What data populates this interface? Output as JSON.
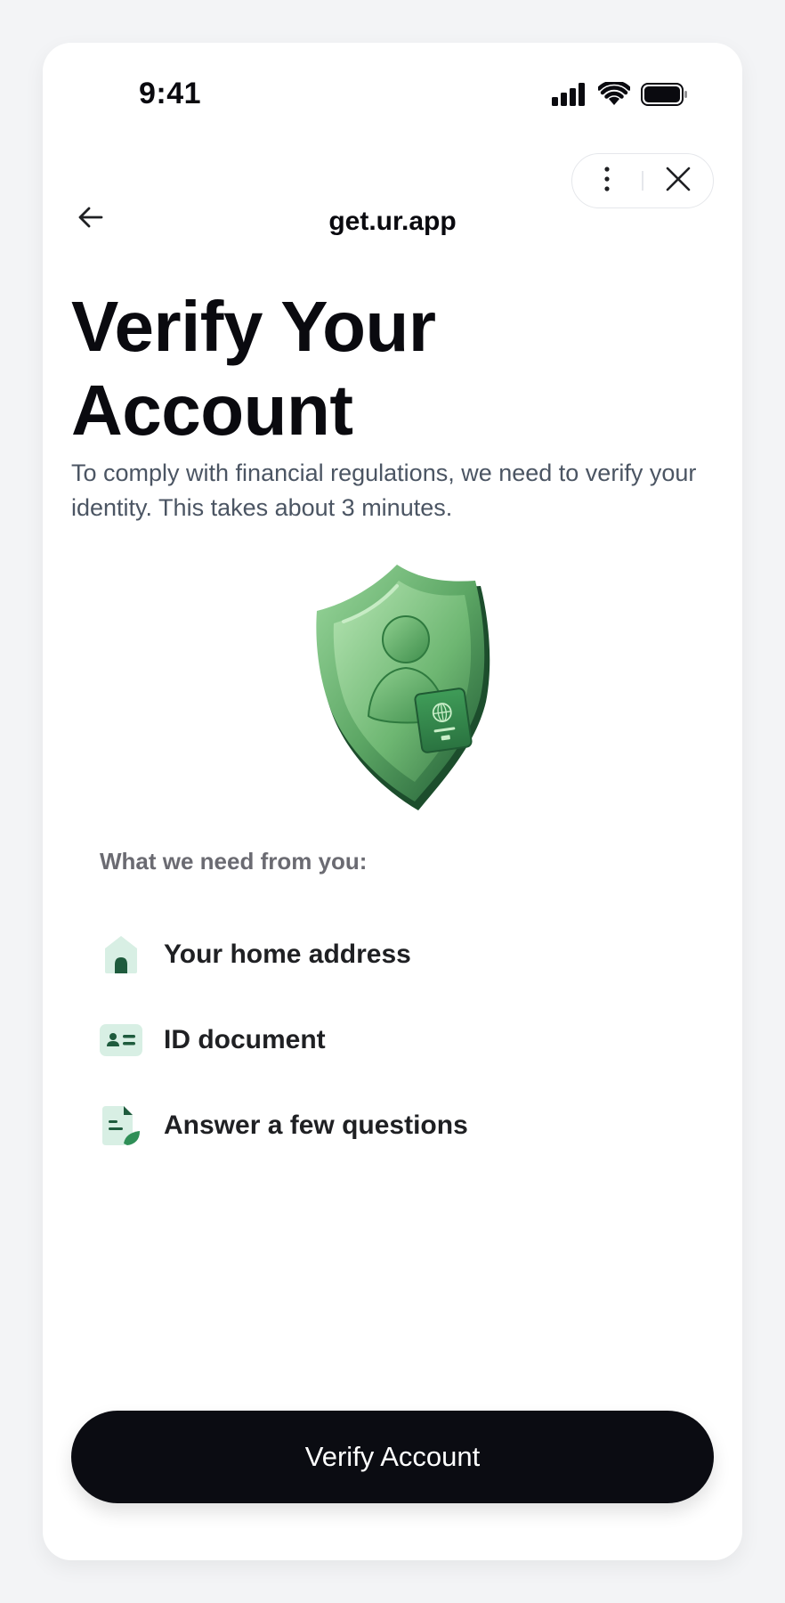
{
  "status_bar": {
    "time": "9:41"
  },
  "nav": {
    "title": "get.ur.app",
    "back_icon": "arrow-left-icon",
    "more_icon": "more-vertical-icon",
    "close_icon": "close-icon"
  },
  "main": {
    "heading": "Verify Your Account",
    "subtitle": "To comply with financial regulations, we need to verify your identity. This takes about 3 minutes.",
    "illustration": "shield-passport-icon",
    "requirements_title": "What we need from you:",
    "requirements": [
      {
        "label": "Your home address",
        "icon": "home-icon"
      },
      {
        "label": "ID document",
        "icon": "id-card-icon"
      },
      {
        "label": "Answer a few questions",
        "icon": "questionnaire-icon"
      }
    ]
  },
  "cta": {
    "label": "Verify Account"
  },
  "colors": {
    "primary": "#0b0c12",
    "accent_green": "#2f8f57",
    "icon_tint": "#dff1e8",
    "text_muted": "#6b6b72"
  }
}
